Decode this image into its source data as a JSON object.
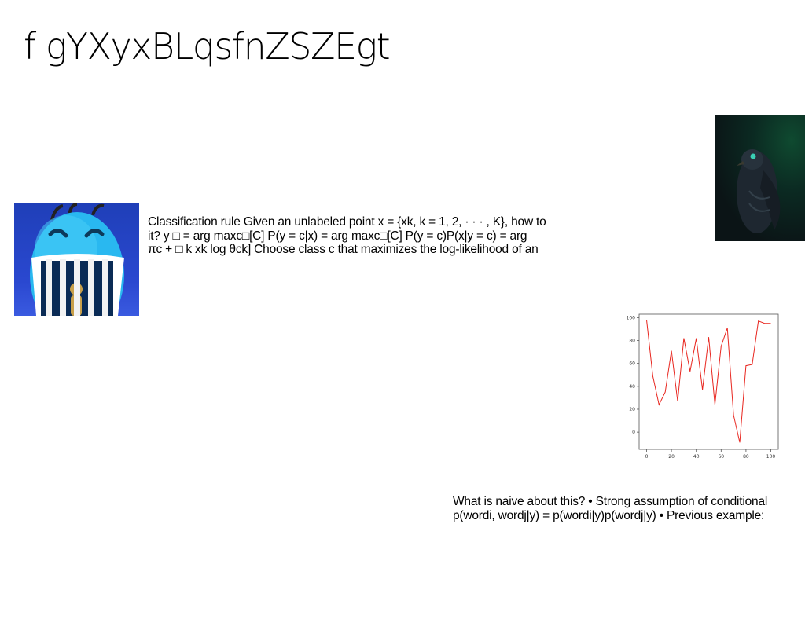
{
  "slide": {
    "title": "f gYXyxBLqsfnZSZEgt",
    "paragraph1_lines": [
      "Classification rule Given an unlabeled point x = {xk, k = 1, 2, · · · , K}, how to",
      "it? y □ = arg maxc□[C] P(y = c|x) = arg maxc□[C] P(y = c)P(x|y = c) = arg",
      "πc + □ k xk log θck] Choose class c that maximizes the log-likelihood of an"
    ],
    "paragraph2_lines": [
      "What is naive about this? • Strong assumption of conditional",
      "p(wordi, wordj|y) = p(wordi|y)p(wordj|y) • Previous example:"
    ]
  },
  "images": {
    "emoji": "blue-grinning-emoji-with-prison-bars",
    "bird": "dark-bird-photo-green-background"
  },
  "chart_data": {
    "type": "line",
    "x": [
      0,
      5,
      10,
      15,
      20,
      25,
      30,
      35,
      40,
      45,
      50,
      55,
      60,
      65,
      70,
      75,
      80,
      85,
      90,
      95,
      100
    ],
    "values": [
      98,
      49,
      24,
      35,
      71,
      27,
      82,
      53,
      82,
      37,
      83,
      24,
      75,
      91,
      15,
      -9,
      58,
      59,
      97,
      95,
      95
    ],
    "color": "#e8261f",
    "xticks": [
      "0",
      "20",
      "40",
      "60",
      "80",
      "100"
    ],
    "yticks": [
      "0",
      "20",
      "40",
      "60",
      "80",
      "100"
    ],
    "xlim": [
      -6,
      106
    ],
    "ylim": [
      -15,
      103
    ],
    "grid": false
  }
}
